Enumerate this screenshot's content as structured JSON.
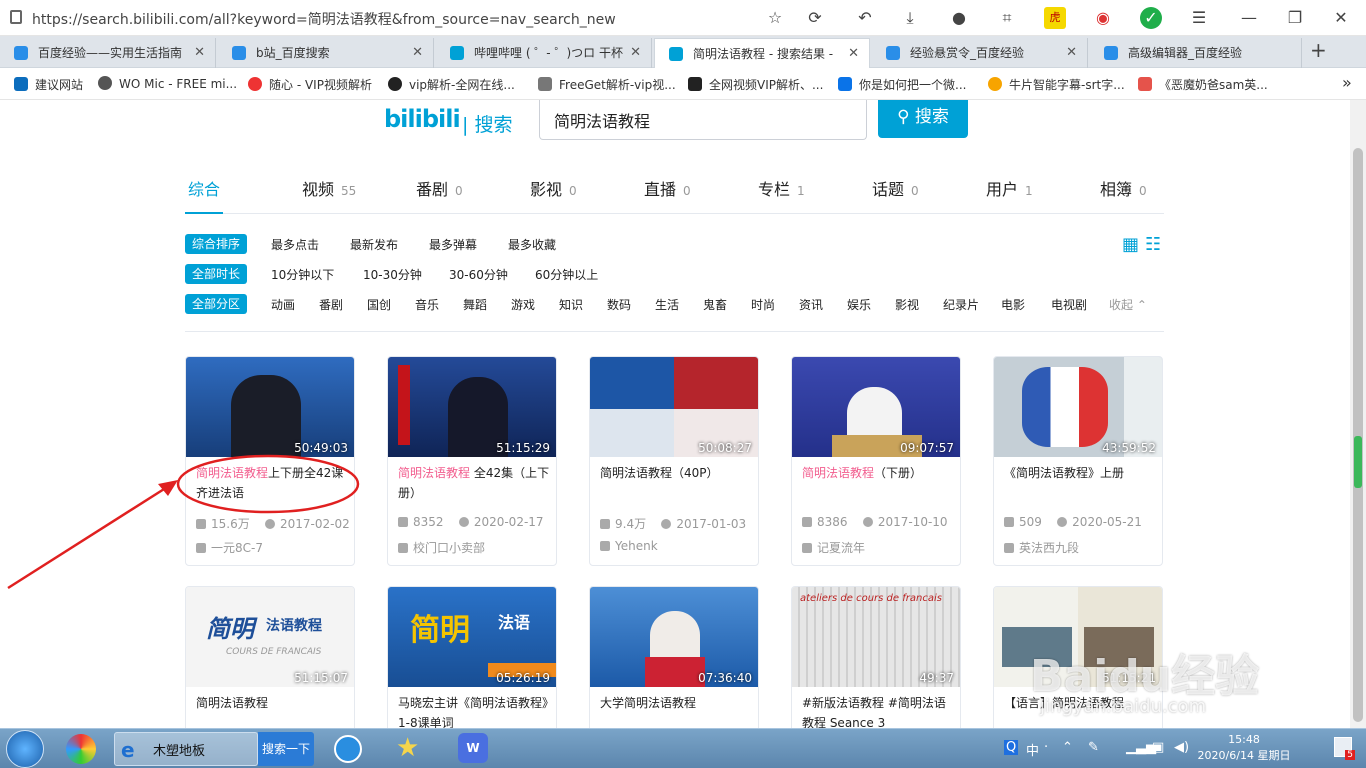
{
  "browser": {
    "url": "https://search.bilibili.com/all?keyword=简明法语教程&from_source=nav_search_new"
  },
  "tabs": [
    {
      "label": "百度经验——实用生活指南",
      "color": "#2a5fd9"
    },
    {
      "label": "b站_百度搜索",
      "color": "#2a5fd9"
    },
    {
      "label": "哔哩哔哩 ( ゜- ゜)つロ 干杯",
      "color": "#00a1d6"
    },
    {
      "label": "简明法语教程 - 搜索结果 -",
      "color": "#00a1d6"
    },
    {
      "label": "经验悬赏令_百度经验",
      "color": "#2a5fd9"
    },
    {
      "label": "高级编辑器_百度经验",
      "color": "#2a5fd9"
    }
  ],
  "bookmarks": [
    {
      "label": "建议网站",
      "color": "#0c6dbd"
    },
    {
      "label": "WO Mic - FREE mi...",
      "color": "#555"
    },
    {
      "label": "随心 - VIP视频解析",
      "color": "#e33"
    },
    {
      "label": "vip解析-全网在线...",
      "color": "#222"
    },
    {
      "label": "FreeGet解析-vip视...",
      "color": "#777"
    },
    {
      "label": "全网视频VIP解析、...",
      "color": "#222"
    },
    {
      "label": "你是如何把一个微...",
      "color": "#0a73e8"
    },
    {
      "label": "牛片智能字幕-srt字...",
      "color": "#f7a400"
    },
    {
      "label": "《恶魔奶爸sam英...",
      "color": "#e5534b"
    }
  ],
  "search": {
    "logo": "bilibili",
    "logo_sep": "| 搜索",
    "query": "简明法语教程",
    "button": "搜索"
  },
  "nav": [
    {
      "label": "综合",
      "count": ""
    },
    {
      "label": "视频",
      "count": "55"
    },
    {
      "label": "番剧",
      "count": "0"
    },
    {
      "label": "影视",
      "count": "0"
    },
    {
      "label": "直播",
      "count": "0"
    },
    {
      "label": "专栏",
      "count": "1"
    },
    {
      "label": "话题",
      "count": "0"
    },
    {
      "label": "用户",
      "count": "1"
    },
    {
      "label": "相簿",
      "count": "0"
    }
  ],
  "filters": {
    "sort": {
      "active": "综合排序",
      "items": [
        "最多点击",
        "最新发布",
        "最多弹幕",
        "最多收藏"
      ]
    },
    "duration": {
      "active": "全部时长",
      "items": [
        "10分钟以下",
        "10-30分钟",
        "30-60分钟",
        "60分钟以上"
      ]
    },
    "zone": {
      "active": "全部分区",
      "items": [
        "动画",
        "番剧",
        "国创",
        "音乐",
        "舞蹈",
        "游戏",
        "知识",
        "数码",
        "生活",
        "鬼畜",
        "时尚",
        "资讯",
        "娱乐",
        "影视",
        "纪录片",
        "电影",
        "电视剧"
      ],
      "collapse": "收起"
    }
  },
  "videos": [
    {
      "hl": "简明法语教程",
      "rest": "上下册全42课 齐进法语",
      "duration": "50:49:03",
      "views": "15.6万",
      "date": "2017-02-02",
      "author": "一元8C-7",
      "thumb": "#2c5fa8"
    },
    {
      "hl": "简明法语教程",
      "rest": " 全42集（上下册）",
      "duration": "51:15:29",
      "views": "8352",
      "date": "2020-02-17",
      "author": "校门口小卖部",
      "thumb": "#1d3f8c"
    },
    {
      "hl": "",
      "rest": "简明法语教程（40P）",
      "duration": "50:08:27",
      "views": "9.4万",
      "date": "2017-01-03",
      "author": "Yehenk",
      "thumb": "#1a4d9a"
    },
    {
      "hl": "简明法语教程",
      "rest": "（下册）",
      "duration": "09:07:57",
      "views": "8386",
      "date": "2017-10-10",
      "author": "记夏流年",
      "thumb": "#2a3f9e"
    },
    {
      "hl": "",
      "rest": "《简明法语教程》上册",
      "duration": "43:59:52",
      "views": "509",
      "date": "2020-05-21",
      "author": "英法西九段",
      "thumb": "#bcc7cf"
    },
    {
      "hl": "",
      "rest": "简明法语教程",
      "duration": "51:15:07",
      "views": "",
      "date": "",
      "author": "",
      "thumb": "#f0f0f0"
    },
    {
      "hl": "",
      "rest": "马晓宏主讲《简明法语教程》1-8课单词",
      "duration": "05:26:19",
      "views": "",
      "date": "",
      "author": "",
      "thumb": "#1f5fa8"
    },
    {
      "hl": "",
      "rest": "大学简明法语教程",
      "duration": "07:36:40",
      "views": "",
      "date": "",
      "author": "",
      "thumb": "#3a78c0"
    },
    {
      "hl": "",
      "rest": "#新版法语教程 #简明法语教程 Seance 3",
      "duration": "49:37",
      "views": "",
      "date": "",
      "author": "",
      "thumb": "#d9d9d9"
    },
    {
      "hl": "",
      "rest": "【语言】简明法语教程",
      "duration": "51:15:21",
      "views": "",
      "date": "",
      "author": "",
      "thumb": "#6b7a6a"
    }
  ],
  "taskbar": {
    "ie_label": "木塑地板",
    "search_btn": "搜索一下",
    "time": "15:48",
    "date": "2020/6/14 星期日",
    "ime": "中"
  }
}
